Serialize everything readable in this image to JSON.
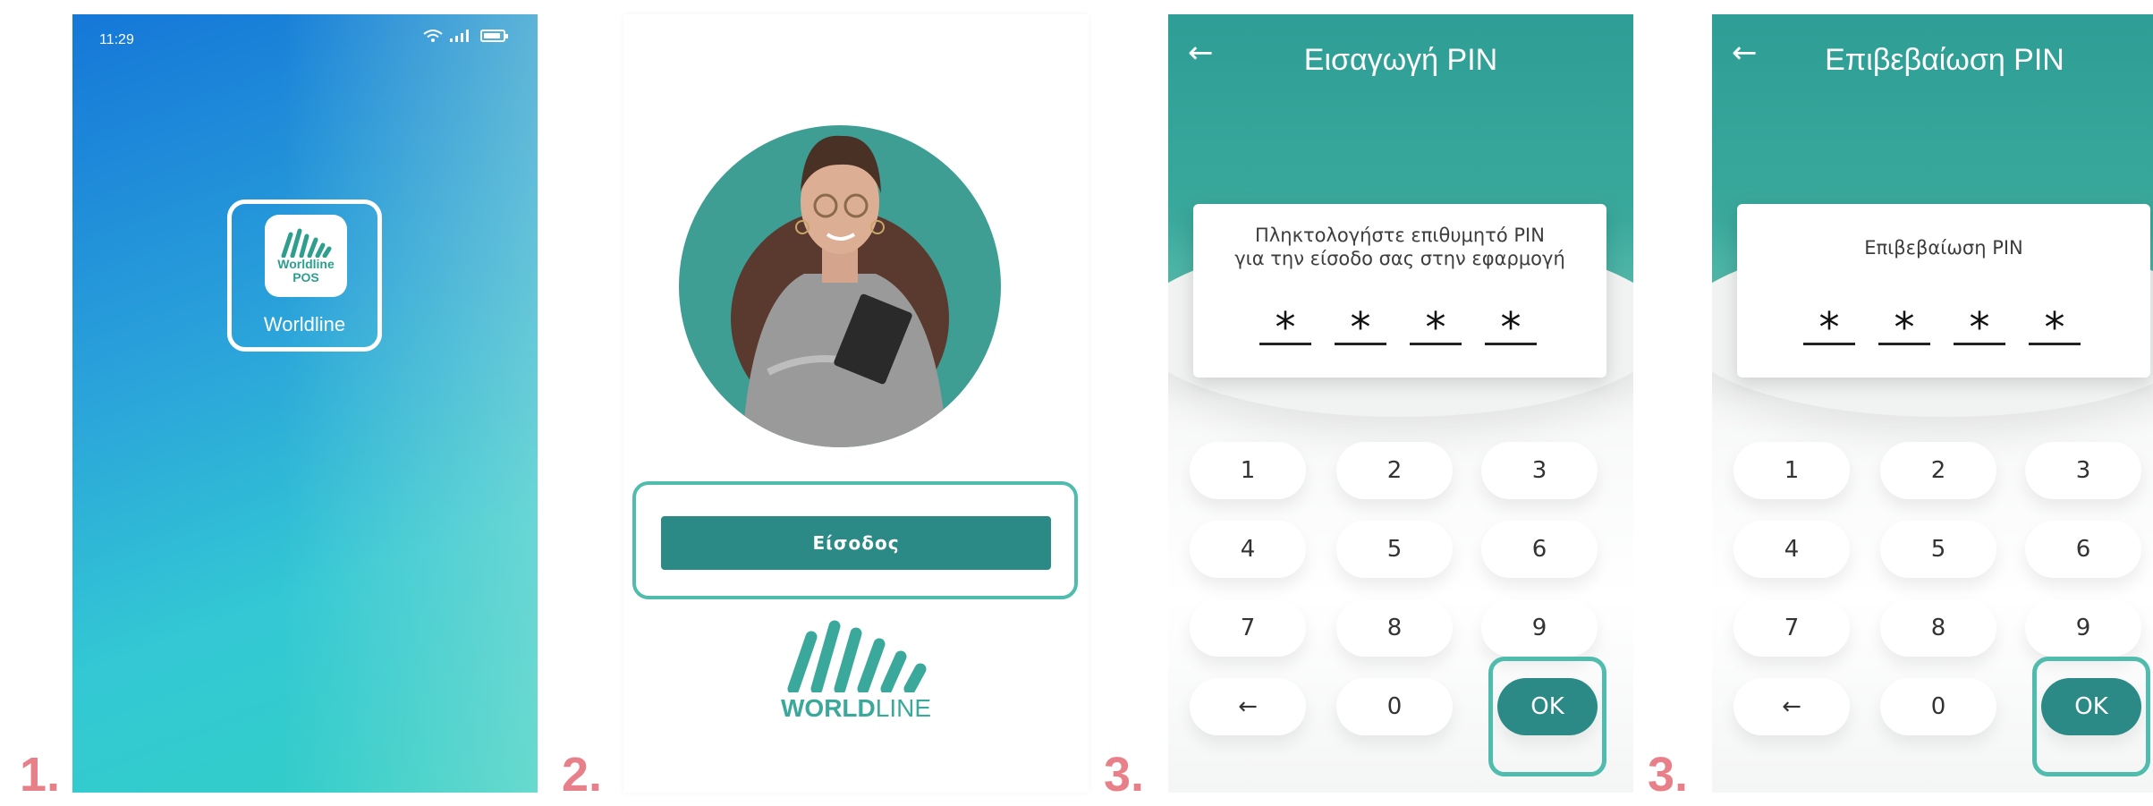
{
  "steps": [
    "1.",
    "2.",
    "3.",
    "3."
  ],
  "screen1": {
    "status_time": "11:29",
    "app_icon_text_line1": "Worldline",
    "app_icon_text_line2": "POS",
    "app_label": "Worldline"
  },
  "screen2": {
    "login_button": "Είσοδος",
    "logo_text_bold": "WORLD",
    "logo_text_light": "LINE"
  },
  "screen3": {
    "title": "Εισαγωγή PIN",
    "prompt_line1": "Πληκτολογήστε επιθυμητό PIN",
    "prompt_line2": "για την είσοδο σας στην εφαρμογή",
    "pin_chars": [
      "*",
      "*",
      "*",
      "*"
    ]
  },
  "screen4": {
    "title": "Επιβεβαίωση PIN",
    "prompt": "Επιβεβαίωση PIN",
    "pin_chars": [
      "*",
      "*",
      "*",
      "*"
    ]
  },
  "keypad": {
    "keys": [
      "1",
      "2",
      "3",
      "4",
      "5",
      "6",
      "7",
      "8",
      "9",
      "←",
      "0",
      "OK"
    ]
  },
  "icons": {
    "back": "←"
  },
  "colors": {
    "accent": "#2c8a86",
    "highlight": "#4fbcae",
    "step_number": "#e8808a"
  }
}
